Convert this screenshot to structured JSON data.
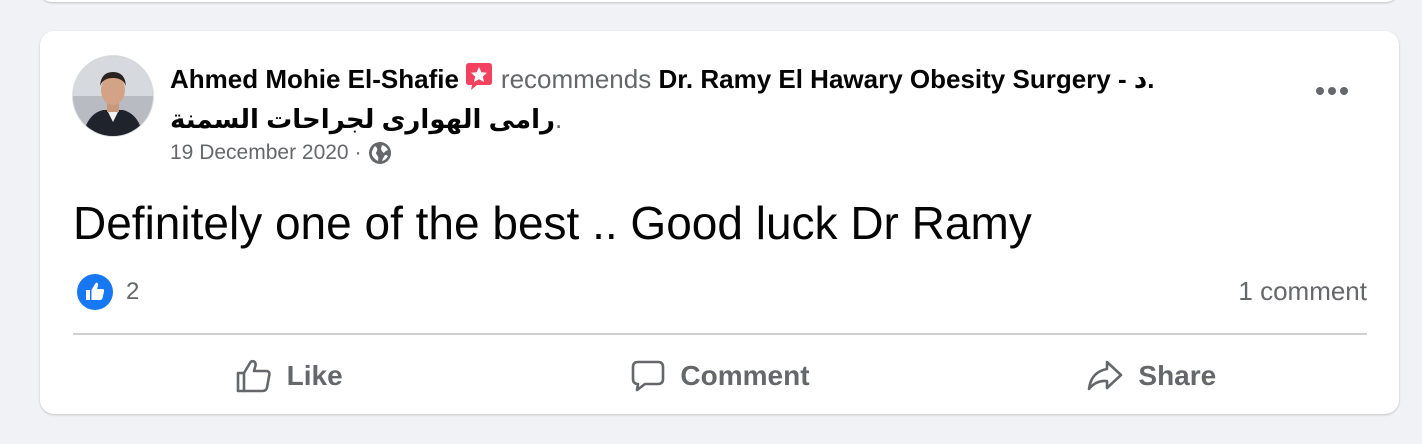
{
  "post": {
    "author": "Ahmed Mohie El-Shafie",
    "verb": "recommends",
    "page_name": "Dr. Ramy El Hawary Obesity Surgery - د.",
    "page_name_ar": "رامى الهوارى لجراحات السمنة",
    "end_dot": ".",
    "date": "19 December 2020",
    "separator": "·",
    "privacy_icon": "globe-icon",
    "text": "Definitely one of the best .. Good luck Dr Ramy",
    "reaction_icon": "like-icon",
    "reaction_count": "2",
    "comments": "1 comment",
    "more_icon": "more-icon"
  },
  "actions": {
    "like": "Like",
    "comment": "Comment",
    "share": "Share"
  },
  "colors": {
    "like_blue": "#1877f2",
    "badge_pink": "#f3425f",
    "secondary_text": "#65676b",
    "page_bg": "#f0f2f5"
  }
}
